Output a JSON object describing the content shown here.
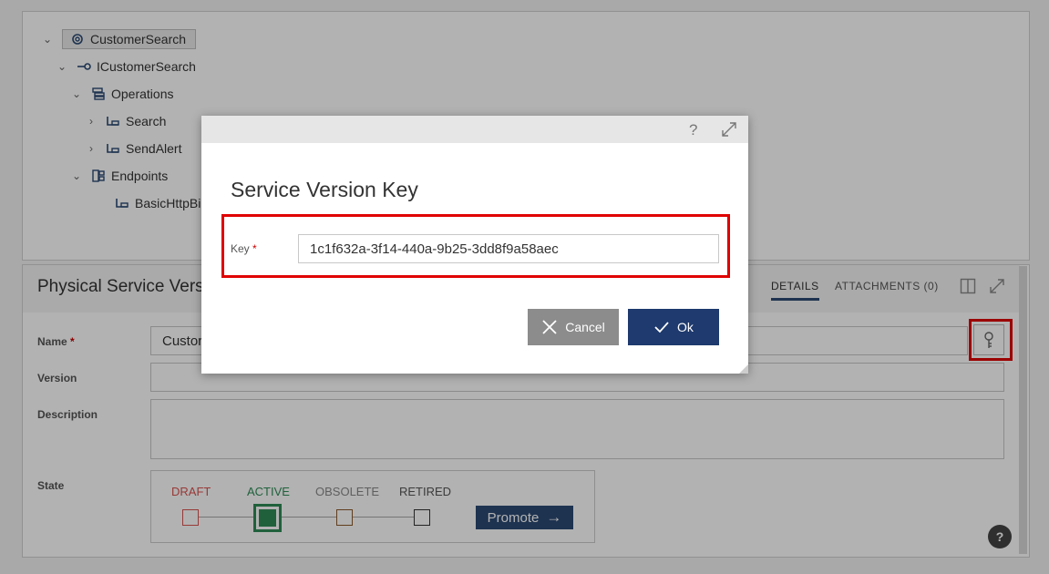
{
  "tree": {
    "root": "CustomerSearch",
    "interface": "ICustomerSearch",
    "operations": "Operations",
    "op_search": "Search",
    "op_sendalert": "SendAlert",
    "endpoints": "Endpoints",
    "endpoint": "BasicHttpBi"
  },
  "detail": {
    "title": "Physical Service Vers",
    "tabs": {
      "details": "DETAILS",
      "attachments": "ATTACHMENTS (0)"
    },
    "name_label": "Name",
    "name_value": "Custor",
    "version_label": "Version",
    "description_label": "Description",
    "state_label": "State",
    "states": {
      "draft": "DRAFT",
      "active": "ACTIVE",
      "obsolete": "OBSOLETE",
      "retired": "RETIRED"
    },
    "promote_label": "Promote",
    "required_mark": "*"
  },
  "dialog": {
    "help": "?",
    "title": "Service Version Key",
    "key_label": "Key",
    "required_mark": "*",
    "key_value": "1c1f632a-3f14-440a-9b25-3dd8f9a58aec",
    "cancel_label": "Cancel",
    "ok_label": "Ok"
  },
  "help_bubble": "?",
  "colors": {
    "draft": "#d9534f",
    "active": "#2e8b57",
    "obsolete": "#8b5a2b",
    "retired": "#333333",
    "ok_button": "#1e3a6e",
    "cancel_button": "#8c8c8c",
    "highlight": "#e00000",
    "promote": "#2b4a73"
  }
}
